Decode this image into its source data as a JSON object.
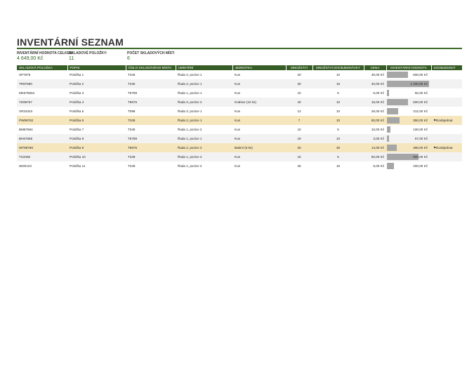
{
  "title": "INVENTÁRNÍ SEZNAM",
  "summary": {
    "total_value_label": "INVENTÁRNÍ HODNOTA CELKEM:",
    "total_value": "4 649,00 Kč",
    "items_label": "SKLADOVÉ POLOŽKY:",
    "items_value": "11",
    "locations_label": "POČET SKLADOVÝCH MÍST:",
    "locations_value": "6"
  },
  "columns": [
    "SKLADOVÁ POLOŽKA",
    "POPIS",
    "ČÍSLO SKLADOVÉHO MÍSTA",
    "UMÍSTĚNÍ",
    "JEDNOTKA",
    "MNOŽSTVÍ",
    "MNOŽSTVÍ DOOBJEDNÁVKY",
    "CENA",
    "INVENTÁRNÍ HODNOTA",
    "DOOBJEDNAT"
  ],
  "bar_color": "#a6a6a6",
  "header_color": "#375d27",
  "reorder_row_color": "#f5e6bd",
  "max_inventory_value": 1200,
  "rows": [
    {
      "item": "SP7875",
      "desc": "Položka 1",
      "bin": "T345",
      "loc": "Řada 2, pozice 1",
      "unit": "Kus",
      "qty": "20",
      "reorder": "10",
      "price": "30,00 Kč",
      "value": "600,00 Kč",
      "value_num": 600,
      "flag": "",
      "flag_label": ""
    },
    {
      "item": "TR87680",
      "desc": "Položka 2",
      "bin": "T345",
      "loc": "Řada 2, pozice 1",
      "unit": "Kus",
      "qty": "30",
      "reorder": "15",
      "price": "40,00 Kč",
      "value": "1 200,00 Kč",
      "value_num": 1200,
      "flag": "",
      "flag_label": ""
    },
    {
      "item": "MK676554",
      "desc": "Položka 3",
      "bin": "T5789",
      "loc": "Řada 1, pozice 1",
      "unit": "Kus",
      "qty": "10",
      "reorder": "5",
      "price": "5,00 Kč",
      "value": "50,00 Kč",
      "value_num": 50,
      "flag": "",
      "flag_label": ""
    },
    {
      "item": "YE98767",
      "desc": "Položka 4",
      "bin": "T9676",
      "loc": "Řada 3, pozice 2",
      "unit": "Krabice (10 ks)",
      "qty": "40",
      "reorder": "10",
      "price": "15,00 Kč",
      "value": "600,00 Kč",
      "value_num": 600,
      "flag": "",
      "flag_label": ""
    },
    {
      "item": "XR23423",
      "desc": "Položka 5",
      "bin": "T098",
      "loc": "Řada 3, pozice 1",
      "unit": "Kus",
      "qty": "12",
      "reorder": "10",
      "price": "26,00 Kč",
      "value": "312,00 Kč",
      "value_num": 312,
      "flag": "",
      "flag_label": ""
    },
    {
      "item": "PW98762",
      "desc": "Položka 6",
      "bin": "T345",
      "loc": "Řada 2, pozice 1",
      "unit": "Kus",
      "qty": "7",
      "reorder": "10",
      "price": "50,00 Kč",
      "value": "350,00 Kč",
      "value_num": 350,
      "flag": "⚑",
      "flag_label": "Doobjednat"
    },
    {
      "item": "BM87684",
      "desc": "Položka 7",
      "bin": "T349",
      "loc": "Řada 1, pozice 2",
      "unit": "Kus",
      "qty": "10",
      "reorder": "5",
      "price": "10,00 Kč",
      "value": "100,00 Kč",
      "value_num": 100,
      "flag": "",
      "flag_label": ""
    },
    {
      "item": "BH67655",
      "desc": "Položka 8",
      "bin": "T5789",
      "loc": "Řada 1, pozice 1",
      "unit": "Kus",
      "qty": "19",
      "reorder": "10",
      "price": "3,00 Kč",
      "value": "57,00 Kč",
      "value_num": 57,
      "flag": "",
      "flag_label": ""
    },
    {
      "item": "WT98768",
      "desc": "Položka 9",
      "bin": "T9675",
      "loc": "Řada 2, pozice 2",
      "unit": "Balení (5 ks)",
      "qty": "20",
      "reorder": "30",
      "price": "14,00 Kč",
      "value": "280,00 Kč",
      "value_num": 280,
      "flag": "⚑",
      "flag_label": "Doobjednat"
    },
    {
      "item": "TS3456",
      "desc": "Položka 10",
      "bin": "T349",
      "loc": "Řada 1, pozice 2",
      "unit": "Kus",
      "qty": "15",
      "reorder": "5",
      "price": "60,00 Kč",
      "value": "900,00 Kč",
      "value_num": 900,
      "flag": "",
      "flag_label": ""
    },
    {
      "item": "WD0123",
      "desc": "Položka 11",
      "bin": "T349",
      "loc": "Řada 1, pozice 2",
      "unit": "Kus",
      "qty": "25",
      "reorder": "15",
      "price": "8,00 Kč",
      "value": "200,00 Kč",
      "value_num": 200,
      "flag": "",
      "flag_label": ""
    }
  ]
}
